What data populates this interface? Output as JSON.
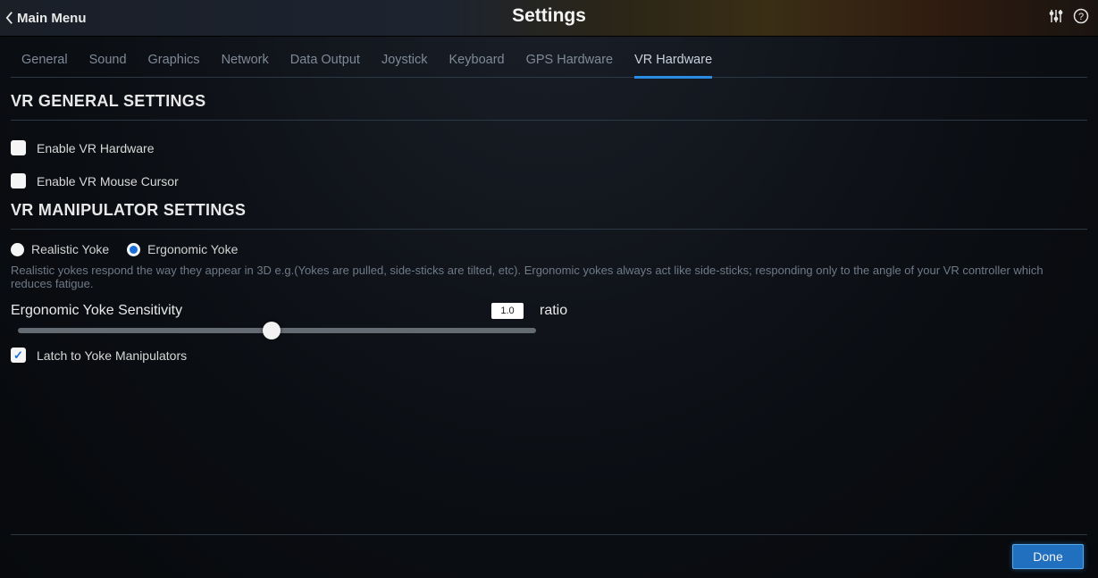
{
  "header": {
    "back_label": "Main Menu",
    "title": "Settings"
  },
  "tabs": [
    {
      "label": "General",
      "active": false
    },
    {
      "label": "Sound",
      "active": false
    },
    {
      "label": "Graphics",
      "active": false
    },
    {
      "label": "Network",
      "active": false
    },
    {
      "label": "Data Output",
      "active": false
    },
    {
      "label": "Joystick",
      "active": false
    },
    {
      "label": "Keyboard",
      "active": false
    },
    {
      "label": "GPS Hardware",
      "active": false
    },
    {
      "label": "VR Hardware",
      "active": true
    }
  ],
  "sections": {
    "general": {
      "title": "VR GENERAL SETTINGS",
      "enable_vr_hardware": {
        "label": "Enable VR Hardware",
        "checked": false
      },
      "enable_vr_mouse": {
        "label": "Enable VR Mouse Cursor",
        "checked": false
      }
    },
    "manipulator": {
      "title": "VR MANIPULATOR SETTINGS",
      "yoke_mode": {
        "options": [
          {
            "label": "Realistic Yoke",
            "selected": false
          },
          {
            "label": "Ergonomic Yoke",
            "selected": true
          }
        ],
        "description": "Realistic yokes respond the way they appear in 3D e.g.(Yokes are pulled, side-sticks are tilted, etc). Ergonomic yokes always act like side-sticks; responding only to the angle of your VR controller which reduces fatigue."
      },
      "sensitivity": {
        "label": "Ergonomic Yoke Sensitivity",
        "value": "1.0",
        "unit": "ratio",
        "slider_percent": 49
      },
      "latch": {
        "label": "Latch to Yoke Manipulators",
        "checked": true
      }
    }
  },
  "footer": {
    "done_label": "Done"
  }
}
